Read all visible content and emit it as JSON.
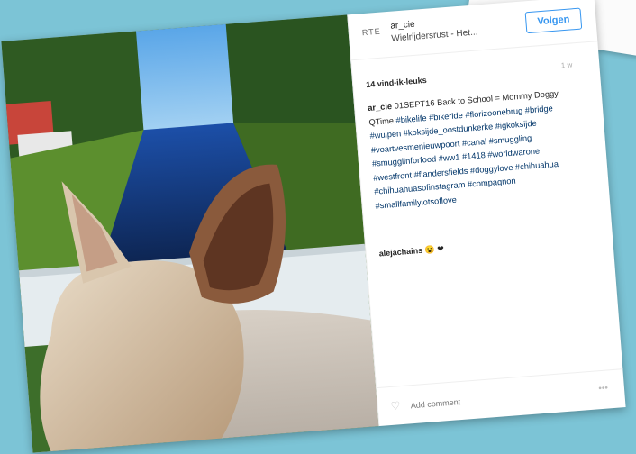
{
  "post": {
    "avatar_text": "RTE",
    "username": "ar_cie",
    "location": "Wielrijdersrust - Het...",
    "follow_label": "Volgen",
    "likes": "14 vind-ik-leuks",
    "time": "1 w",
    "caption_user": "ar_cie",
    "caption_text": "01SEPT16 Back to School = Mommy Doggy QTime",
    "hashtags": "#bikelife #bikeride #florizoonebrug #bridge #wulpen #koksijde_oostdunkerke #igkoksijde #voartvesmenieuwpoort #canal #smuggling #smugglinforfood #ww1 #1418 #worldwarone #westfront #flandersfields #doggylove #chihuahua #chihuahuasofinstagram #compagnon #smallfamilylotsoflove",
    "comment_user": "alejachains",
    "comment_text": "😮 ❤",
    "add_comment_placeholder": "Add comment",
    "more": "•••"
  },
  "colors": {
    "background": "#7cc4d6",
    "accent": "#3897f0",
    "hashtag": "#003569"
  },
  "icons": {
    "heart": "heart-icon",
    "more": "more-options-icon"
  }
}
